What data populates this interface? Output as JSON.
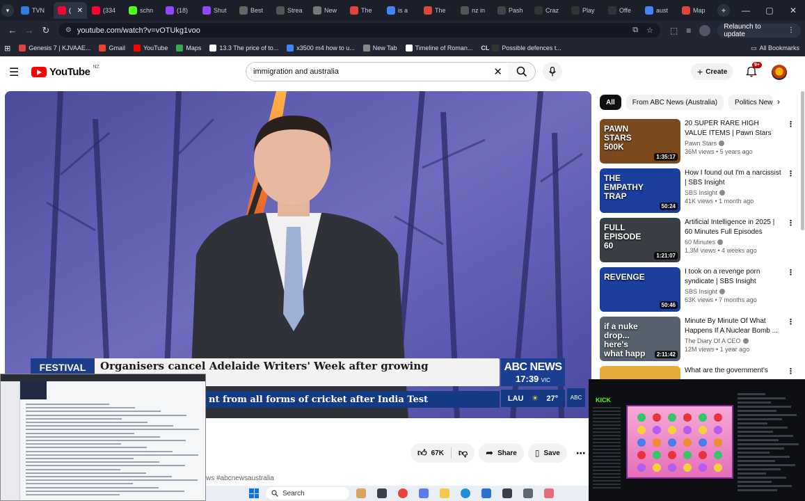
{
  "browser": {
    "tabs": [
      {
        "label": "TVN",
        "color": "#2f7de1"
      },
      {
        "label": "(",
        "color": "#ff0033",
        "active": true
      },
      {
        "label": "(334",
        "color": "#ff0033"
      },
      {
        "label": "schn",
        "color": "#53fc18"
      },
      {
        "label": "(18)",
        "color": "#9146ff"
      },
      {
        "label": "Shut",
        "color": "#9146ff"
      },
      {
        "label": "Best",
        "color": "#666666"
      },
      {
        "label": "Strea",
        "color": "#555555"
      },
      {
        "label": "New",
        "color": "#777777"
      },
      {
        "label": "The",
        "color": "#e0453a"
      },
      {
        "label": "is a",
        "color": "#4285f4"
      },
      {
        "label": "The",
        "color": "#e0453a"
      },
      {
        "label": "nz in",
        "color": "#555555"
      },
      {
        "label": "Pash",
        "color": "#444444"
      },
      {
        "label": "Craz",
        "color": "#333333"
      },
      {
        "label": "Play",
        "color": "#333333"
      },
      {
        "label": "Offe",
        "color": "#333333"
      },
      {
        "label": "aust",
        "color": "#4285f4"
      },
      {
        "label": "Map",
        "color": "#e0453a"
      }
    ],
    "url": "youtube.com/watch?v=vOTUkg1voo",
    "relaunch_label": "Relaunch to update",
    "bookmarks": [
      {
        "label": "Genesis 7 | KJVAAE...",
        "color": "#e04141"
      },
      {
        "label": "Gmail",
        "color": "#ea4335"
      },
      {
        "label": "YouTube",
        "color": "#ff0000"
      },
      {
        "label": "Maps",
        "color": "#34a853"
      },
      {
        "label": "13.3 The price of to...",
        "color": "#ffffff"
      },
      {
        "label": "x3500 m4 how to u...",
        "color": "#4285f4"
      },
      {
        "label": "New Tab",
        "color": "#888888"
      },
      {
        "label": "Timeline of Roman...",
        "color": "#ffffff"
      },
      {
        "label": "Possible defences t...",
        "color": "#333333"
      }
    ],
    "bookmarks_prefix": [
      "CL"
    ],
    "all_bookmarks": "All Bookmarks"
  },
  "youtube": {
    "logo_text": "YouTube",
    "region": "NZ",
    "search_value": "immigration and australia",
    "create_label": "Create",
    "notification_count": "9+"
  },
  "video": {
    "festival_tag": "FESTIVAL",
    "headline": "Organisers cancel Adelaide Writers' Week after growing controversy",
    "ticker": "nt from all forms of cricket after India Test",
    "channel_bug": "ABC NEWS",
    "time": "17:39",
    "zone": "VIC",
    "weather_city": "LAU",
    "weather_temp": "27°",
    "corner_bug": "ABC"
  },
  "actions": {
    "like_count": "67K",
    "share_label": "Share",
    "save_label": "Save",
    "hashtags": "ws #abcnewsaustralia"
  },
  "chips": [
    "All",
    "From ABC News (Australia)",
    "Politics News"
  ],
  "recommendations": [
    {
      "title": "20 SUPER RARE HIGH VALUE ITEMS | Pawn Stars",
      "channel": "Pawn Stars",
      "meta": "36M views • 5 years ago",
      "duration": "1:35:17",
      "thumb_text": "PAWN STARS 500K",
      "thumb_color": "#7a4a1e"
    },
    {
      "title": "How I found out I'm a narcissist | SBS Insight",
      "channel": "SBS Insight",
      "meta": "41K views • 1 month ago",
      "duration": "50:24",
      "thumb_text": "THE EMPATHY TRAP",
      "thumb_color": "#1b3f9e"
    },
    {
      "title": "Artificial Intelligence in 2025 | 60 Minutes Full Episodes",
      "channel": "60 Minutes",
      "meta": "1.3M views • 4 weeks ago",
      "duration": "1:21:07",
      "thumb_text": "FULL EPISODE 60",
      "thumb_color": "#3a3d44"
    },
    {
      "title": "I took on a revenge porn syndicate | SBS Insight",
      "channel": "SBS Insight",
      "meta": "63K views • 7 months ago",
      "duration": "50:46",
      "thumb_text": "REVENGE",
      "thumb_color": "#1b3f9e"
    },
    {
      "title": "Minute By Minute Of What Happens If A Nuclear Bomb ...",
      "channel": "The Diary Of A CEO",
      "meta": "12M views • 1 year ago",
      "duration": "2:11:42",
      "thumb_text": "if a nuke drop... here's what happ",
      "thumb_color": "#56616e"
    },
    {
      "title": "What are the government's",
      "channel": "",
      "meta": "",
      "duration": "",
      "thumb_text": "",
      "thumb_color": "#e9a93a"
    }
  ],
  "taskbar": {
    "search_label": "Search"
  }
}
